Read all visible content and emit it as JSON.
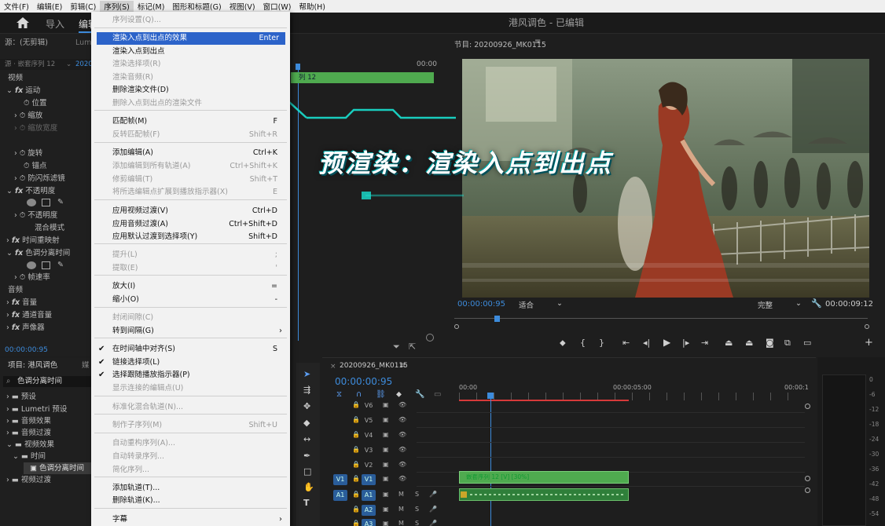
{
  "menubar": [
    "文件(F)",
    "编辑(E)",
    "剪辑(C)",
    "序列(S)",
    "标记(M)",
    "图形和标题(G)",
    "视图(V)",
    "窗口(W)",
    "帮助(H)"
  ],
  "workspace": {
    "tabs": [
      "导入",
      "编辑"
    ],
    "title": "港风调色 - 已编辑"
  },
  "effect_controls": {
    "source_label": "源：(无剪辑)",
    "tab_lumetri": "Lumet",
    "seq_label": "源 · 嵌套序列 12",
    "seq_time": "2020",
    "video_header": "视频",
    "motion": "运动",
    "position": "位置",
    "scale": "缩放",
    "scale_width": "缩放宽度",
    "rotation": "旋转",
    "anchor": "锚点",
    "antiflicker": "防闪烁滤镜",
    "opacity": "不透明度",
    "opacity_prop": "不透明度",
    "blend_mode": "混合模式",
    "time_remap": "时间重映射",
    "color_sep_time": "色调分离时间",
    "track_rate": "帧速率",
    "audio_header": "音频",
    "volume": "音量",
    "channel_volume": "通道音量",
    "panner": "声像器",
    "timecode": "00:00:00:95"
  },
  "project": {
    "title": "项目: 港风调色",
    "tab2": "媒",
    "search_value": "色调分离时间",
    "tree": [
      {
        "label": "预设"
      },
      {
        "label": "Lumetri 预设"
      },
      {
        "label": "音频效果"
      },
      {
        "label": "音频过渡"
      },
      {
        "label": "视频效果"
      },
      {
        "label": "时间"
      },
      {
        "label": "色调分离时间"
      },
      {
        "label": "视频过渡"
      }
    ]
  },
  "menu": {
    "items": [
      {
        "label": "序列设置(Q)...",
        "shortcut": "",
        "disabled": true
      },
      {
        "label": "渲染入点到出点的效果",
        "shortcut": "Enter",
        "highlight": true
      },
      {
        "label": "渲染入点到出点",
        "shortcut": ""
      },
      {
        "label": "渲染选择项(R)",
        "shortcut": "",
        "disabled": true
      },
      {
        "label": "渲染音频(R)",
        "shortcut": "",
        "disabled": true
      },
      {
        "label": "删除渲染文件(D)",
        "shortcut": ""
      },
      {
        "label": "删除入点到出点的渲染文件",
        "shortcut": "",
        "disabled": true
      },
      {
        "label": "匹配帧(M)",
        "shortcut": "F"
      },
      {
        "label": "反转匹配帧(F)",
        "shortcut": "Shift+R",
        "disabled": true
      },
      {
        "label": "添加编辑(A)",
        "shortcut": "Ctrl+K"
      },
      {
        "label": "添加编辑到所有轨道(A)",
        "shortcut": "Ctrl+Shift+K",
        "disabled": true
      },
      {
        "label": "修剪编辑(T)",
        "shortcut": "Shift+T",
        "disabled": true
      },
      {
        "label": "将所选编辑点扩展到播放指示器(X)",
        "shortcut": "E",
        "disabled": true
      },
      {
        "label": "应用视频过渡(V)",
        "shortcut": "Ctrl+D"
      },
      {
        "label": "应用音频过渡(A)",
        "shortcut": "Ctrl+Shift+D"
      },
      {
        "label": "应用默认过渡到选择项(Y)",
        "shortcut": "Shift+D"
      },
      {
        "label": "提升(L)",
        "shortcut": ";",
        "disabled": true
      },
      {
        "label": "提取(E)",
        "shortcut": "'",
        "disabled": true
      },
      {
        "label": "放大(I)",
        "shortcut": "="
      },
      {
        "label": "缩小(O)",
        "shortcut": "-"
      },
      {
        "label": "封闭间隙(C)",
        "shortcut": "",
        "disabled": true
      },
      {
        "label": "转到间隔(G)",
        "shortcut": "",
        "submenu": true
      },
      {
        "label": "在时间轴中对齐(S)",
        "shortcut": "S",
        "checked": true
      },
      {
        "label": "链接选择项(L)",
        "shortcut": "",
        "checked": true
      },
      {
        "label": "选择跟随播放指示器(P)",
        "shortcut": "",
        "checked": true
      },
      {
        "label": "显示连接的编辑点(U)",
        "shortcut": "",
        "disabled": true
      },
      {
        "label": "标准化混合轨道(N)...",
        "shortcut": "",
        "disabled": true
      },
      {
        "label": "制作子序列(M)",
        "shortcut": "Shift+U",
        "disabled": true
      },
      {
        "label": "自动重构序列(A)...",
        "shortcut": "",
        "disabled": true
      },
      {
        "label": "自动转录序列...",
        "shortcut": "",
        "disabled": true
      },
      {
        "label": "简化序列...",
        "shortcut": "",
        "disabled": true
      },
      {
        "label": "添加轨道(T)...",
        "shortcut": ""
      },
      {
        "label": "删除轨道(K)...",
        "shortcut": ""
      },
      {
        "label": "字幕",
        "shortcut": "",
        "submenu": true
      }
    ]
  },
  "source_monitor": {
    "time": "00:00",
    "clip": "列 12"
  },
  "program": {
    "title": "节目: 20200926_MK0115",
    "timecode": "00:00:00:95",
    "fit": "适合",
    "quality": "完整",
    "duration": "00:00:09:12"
  },
  "overlay": {
    "text": "预渲染：渲染入点到出点"
  },
  "timeline": {
    "tab": "20200926_MK0115",
    "timecode": "00:00:00:95",
    "ruler": [
      "00:00",
      "00:00:05:00",
      "00:00:1"
    ],
    "video_tracks": [
      "V6",
      "V5",
      "V4",
      "V3",
      "V2",
      "V1"
    ],
    "audio_tracks": [
      "A1",
      "A2",
      "A3"
    ],
    "src_v": "V1",
    "src_a": "A1",
    "clip_label": "嵌套序列 12 [V] [30%]"
  },
  "meter": {
    "labels": [
      "0",
      "-6",
      "-12",
      "-18",
      "-24",
      "-30",
      "-36",
      "-42",
      "-48",
      "-54"
    ]
  },
  "colors": {
    "accent": "#2c63c9",
    "timecode": "#3d8bdb",
    "clip_green": "#4faa4f",
    "glow": "#19e0d0"
  }
}
